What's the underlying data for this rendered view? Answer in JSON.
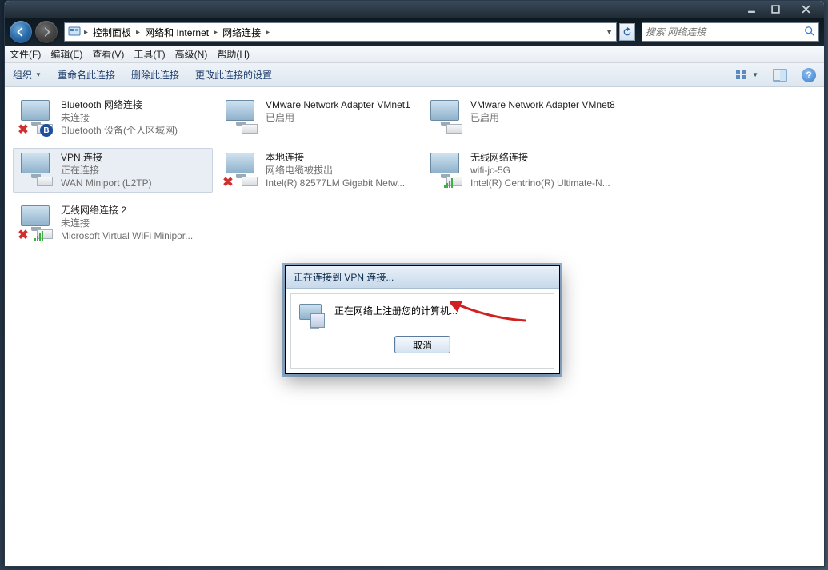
{
  "window": {
    "btn_min_label": "Minimize",
    "btn_max_label": "Maximize",
    "btn_close_label": "Close"
  },
  "breadcrumbs": {
    "root_icon": "control-panel",
    "items": [
      "控制面板",
      "网络和 Internet",
      "网络连接"
    ]
  },
  "search": {
    "placeholder": "搜索 网络连接"
  },
  "menubar": {
    "file": "文件(F)",
    "edit": "编辑(E)",
    "view": "查看(V)",
    "tools": "工具(T)",
    "advanced": "高级(N)",
    "help": "帮助(H)"
  },
  "toolbar": {
    "organize": "组织",
    "rename": "重命名此连接",
    "delete": "删除此连接",
    "change": "更改此连接的设置"
  },
  "connections": [
    {
      "name": "Bluetooth 网络连接",
      "status": "未连接",
      "device": "Bluetooth 设备(个人区域网)",
      "overlay": "x-bt"
    },
    {
      "name": "VMware Network Adapter VMnet1",
      "status": "已启用",
      "device": "",
      "overlay": ""
    },
    {
      "name": "VMware Network Adapter VMnet8",
      "status": "已启用",
      "device": "",
      "overlay": ""
    },
    {
      "name": "VPN 连接",
      "status": "正在连接",
      "device": "WAN Miniport (L2TP)",
      "overlay": "",
      "selected": true
    },
    {
      "name": "本地连接",
      "status": "网络电缆被拔出",
      "device": "Intel(R) 82577LM Gigabit Netw...",
      "overlay": "x"
    },
    {
      "name": "无线网络连接",
      "status": "wifi-jc-5G",
      "device": "Intel(R) Centrino(R) Ultimate-N...",
      "overlay": "bars"
    },
    {
      "name": "无线网络连接 2",
      "status": "未连接",
      "device": "Microsoft Virtual WiFi Minipor...",
      "overlay": "x-bars"
    }
  ],
  "dialog": {
    "title": "正在连接到 VPN 连接...",
    "message": "正在网络上注册您的计算机...",
    "cancel": "取消"
  }
}
